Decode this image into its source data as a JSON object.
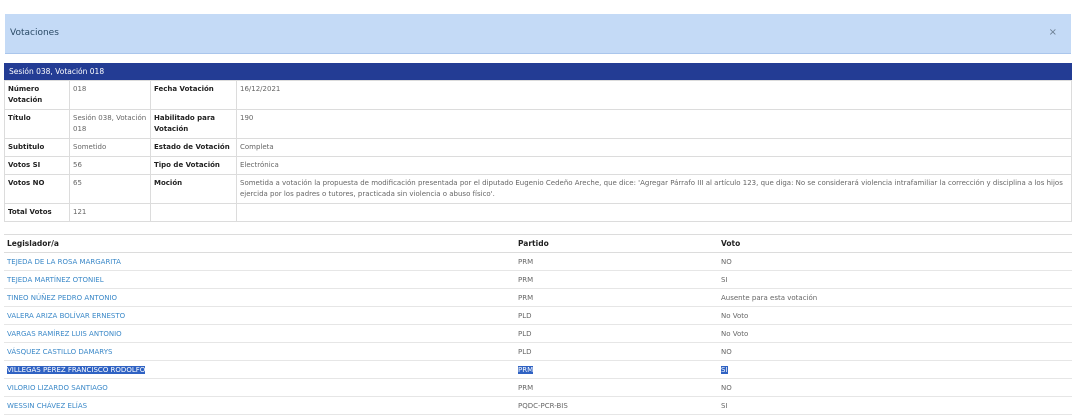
{
  "modal": {
    "title": "Votaciones",
    "close": "×"
  },
  "session": {
    "header": "Sesión 038, Votación 018"
  },
  "details": {
    "numero_label": "Número Votación",
    "numero_value": "018",
    "fecha_label": "Fecha Votación",
    "fecha_value": "16/12/2021",
    "titulo_label": "Título",
    "titulo_value": "Sesión 038, Votación 018",
    "habilitado_label": "Habilitado para Votación",
    "habilitado_value": "190",
    "subtitulo_label": "Subtitulo",
    "subtitulo_value": "Sometido",
    "estado_label": "Estado de Votación",
    "estado_value": "Completa",
    "votos_si_label": "Votos SI",
    "votos_si_value": "56",
    "tipo_label": "Tipo de Votación",
    "tipo_value": "Electrónica",
    "votos_no_label": "Votos NO",
    "votos_no_value": "65",
    "mocion_label": "Moción",
    "mocion_value": "Sometida a votación la propuesta de modificación presentada por el diputado Eugenio Cedeño Areche, que dice: 'Agregar Párrafo III al artículo 123, que diga: No se considerará violencia intrafamiliar la corrección y disciplina a los hijos ejercida por los padres o tutores, practicada sin violencia o abuso físico'.",
    "total_label": "Total Votos",
    "total_value": "121"
  },
  "votes": {
    "headers": {
      "legislator": "Legislador/a",
      "party": "Partido",
      "vote": "Voto"
    },
    "rows": [
      {
        "name": "TEJEDA DE LA ROSA MARGARITA",
        "party": "PRM",
        "vote": "NO"
      },
      {
        "name": "TEJEDA MARTÍNEZ OTONIEL",
        "party": "PRM",
        "vote": "SI"
      },
      {
        "name": "TINEO NÚÑEZ PEDRO ANTONIO",
        "party": "PRM",
        "vote": "Ausente para esta votación"
      },
      {
        "name": "VALERA ARIZA BOLÍVAR ERNESTO",
        "party": "PLD",
        "vote": "No Voto"
      },
      {
        "name": "VARGAS RAMÍREZ LUIS ANTONIO",
        "party": "PLD",
        "vote": "No Voto"
      },
      {
        "name": "VÁSQUEZ CASTILLO DAMARYS",
        "party": "PLD",
        "vote": "NO"
      },
      {
        "name": "VILLEGAS PÉREZ FRANCISCO RODOLFO",
        "party": "PRM",
        "vote": "SI"
      },
      {
        "name": "VILORIO LIZARDO SANTIAGO",
        "party": "PRM",
        "vote": "NO"
      },
      {
        "name": "WESSIN CHÁVEZ ELÍAS",
        "party": "PQDC-PCR-BIS",
        "vote": "SI"
      }
    ]
  },
  "colors": {
    "header_bg": "#c4daf6",
    "session_bar": "#233c94",
    "link": "#3a88c8",
    "selection": "#2f62c3"
  }
}
